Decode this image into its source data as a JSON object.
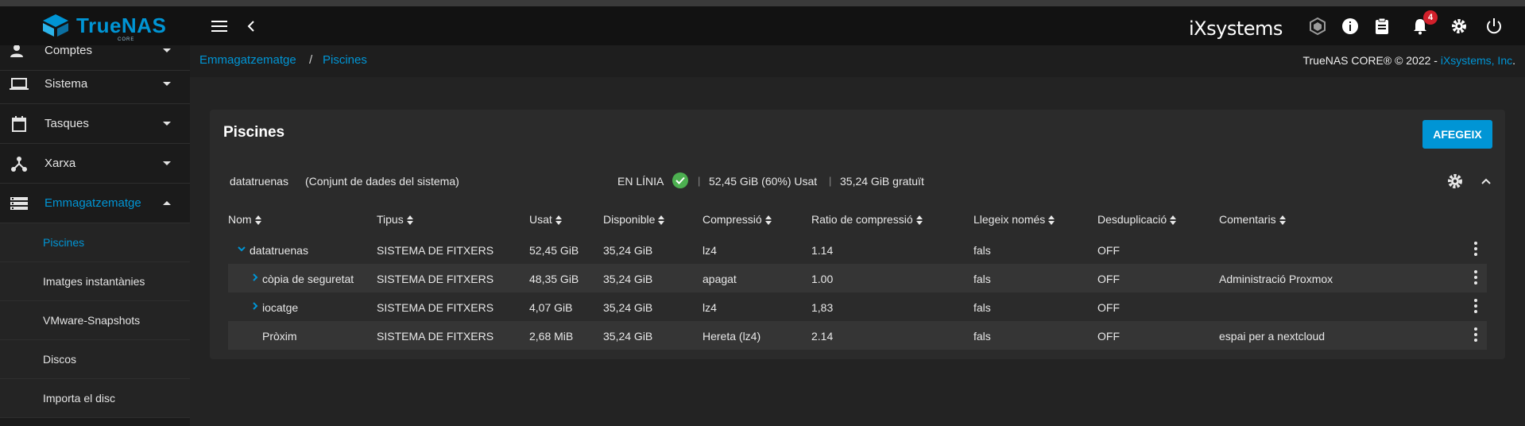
{
  "header": {
    "logo_text": "TrueNAS",
    "logo_sub": "CORE",
    "ix_logo_text": "iXsystems",
    "notification_count": "4",
    "icons": [
      "menu-icon",
      "chevron-left-icon",
      "truecommand-icon",
      "info-icon",
      "clipboard-icon",
      "bell-icon",
      "gear-icon",
      "power-icon"
    ]
  },
  "sidebar": {
    "items": [
      {
        "label": "Comptes",
        "icon": "accounts-icon"
      },
      {
        "label": "Sistema",
        "icon": "laptop-icon"
      },
      {
        "label": "Tasques",
        "icon": "calendar-icon"
      },
      {
        "label": "Xarxa",
        "icon": "network-icon"
      },
      {
        "label": "Emmagatzematge",
        "icon": "storage-icon"
      }
    ],
    "sub_items": [
      {
        "label": "Piscines"
      },
      {
        "label": "Imatges instantànies"
      },
      {
        "label": "VMware-Snapshots"
      },
      {
        "label": "Discos"
      },
      {
        "label": "Importa el disc"
      }
    ]
  },
  "breadcrumb": {
    "parent": "Emmagatzematge",
    "separator": "/",
    "current": "Piscines"
  },
  "copyright": {
    "text": "TrueNAS CORE® © 2022 - ",
    "link": "iXsystems, Inc",
    "suffix": "."
  },
  "card": {
    "title": "Piscines",
    "add_button": "AFEGEIX"
  },
  "pool": {
    "name": "datatruenas",
    "description": "(Conjunt de dades del sistema)",
    "status": "EN LÍNIA",
    "separator": "|",
    "used": "52,45 GiB (60%) Usat",
    "free": "35,24 GiB gratuït"
  },
  "table": {
    "columns": [
      "Nom",
      "Tipus",
      "Usat",
      "Disponible",
      "Compressió",
      "Ratio de compressió",
      "Llegeix només",
      "Desduplicació",
      "Comentaris"
    ],
    "rows": [
      {
        "name": "datatruenas",
        "type": "SISTEMA DE FITXERS",
        "used": "52,45 GiB",
        "available": "35,24 GiB",
        "compression": "lz4",
        "ratio": "1.14",
        "readonly": "fals",
        "dedup": "OFF",
        "comments": ""
      },
      {
        "name": "còpia de seguretat",
        "type": "SISTEMA DE FITXERS",
        "used": "48,35 GiB",
        "available": "35,24 GiB",
        "compression": "apagat",
        "ratio": "1.00",
        "readonly": "fals",
        "dedup": "OFF",
        "comments": "Administració Proxmox"
      },
      {
        "name": "iocatge",
        "type": "SISTEMA DE FITXERS",
        "used": "4,07 GiB",
        "available": "35,24 GiB",
        "compression": "lz4",
        "ratio": "1,83",
        "readonly": "fals",
        "dedup": "OFF",
        "comments": ""
      },
      {
        "name": "Pròxim",
        "type": "SISTEMA DE FITXERS",
        "used": "2,68 MiB",
        "available": "35,24 GiB",
        "compression": "Hereta (lz4)",
        "ratio": "2.14",
        "readonly": "fals",
        "dedup": "OFF",
        "comments": "espai per a nextcloud"
      }
    ]
  },
  "colors": {
    "accent": "#0095d5",
    "status_ok": "#4caf50",
    "badge": "#d2202b"
  }
}
